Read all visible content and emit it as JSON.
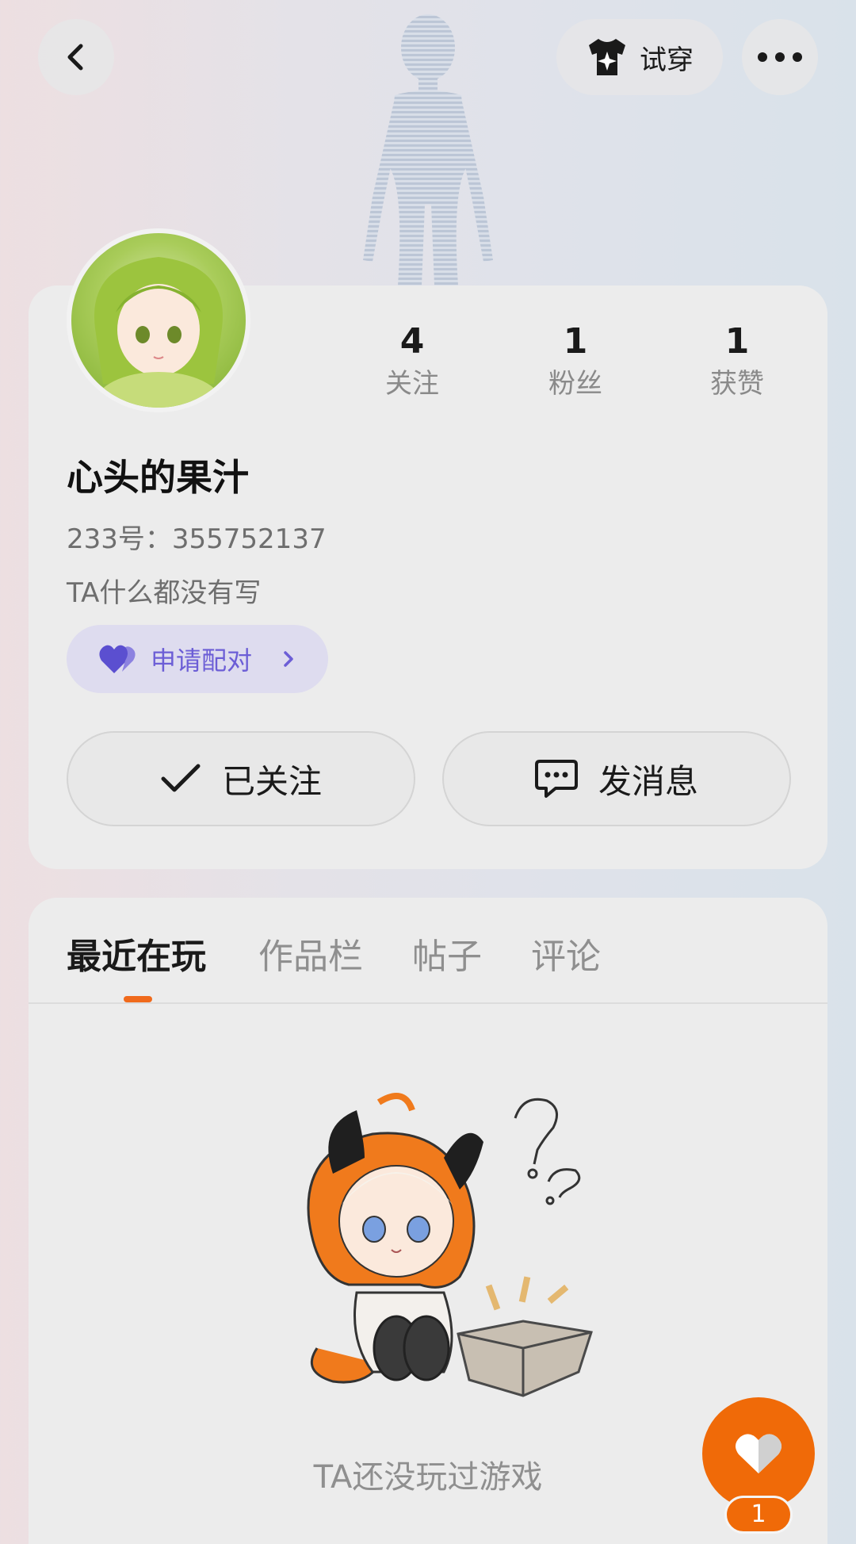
{
  "topbar": {
    "back_icon": "chevron-left-icon",
    "tryon_label": "试穿",
    "more_icon": "more-dots-icon"
  },
  "profile": {
    "stats": [
      {
        "value": "4",
        "label": "关注"
      },
      {
        "value": "1",
        "label": "粉丝"
      },
      {
        "value": "1",
        "label": "获赞"
      }
    ],
    "username": "心头的果汁",
    "uid": "233号：355752137",
    "bio": "TA什么都没有写",
    "pair_label": "申请配对",
    "follow_label": "已关注",
    "message_label": "发消息"
  },
  "tabs": [
    {
      "label": "最近在玩",
      "active": true
    },
    {
      "label": "作品栏",
      "active": false
    },
    {
      "label": "帖子",
      "active": false
    },
    {
      "label": "评论",
      "active": false
    }
  ],
  "empty_state": {
    "text": "TA还没玩过游戏"
  },
  "like": {
    "count": "1"
  },
  "colors": {
    "accent": "#f06a08",
    "pair_text": "#6c5ed6",
    "pair_bg": "#dedcef"
  }
}
